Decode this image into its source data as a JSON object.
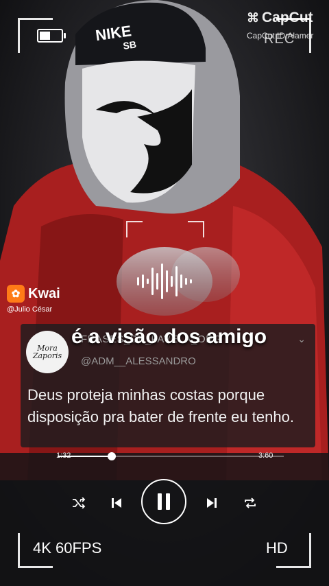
{
  "overlay": {
    "capcut_logo": "CapCut",
    "capcut_id": "CapCut ID:Alamer",
    "rec_label": "REC",
    "battery_level": 0.55
  },
  "kwai": {
    "brand": "Kwai",
    "user": "@Julio César"
  },
  "caption": "é a visão dos amigo",
  "tweet": {
    "avatar_text": "Mora Zaporis",
    "display_name": "FRASES_DE_FAVELA_ORG",
    "handle": "@ADM__ALESSANDRO",
    "text": "Deus proteja minhas costas porque disposição pra bater de frente eu tenho."
  },
  "player": {
    "current_time": "1:32",
    "total_time": "3:60",
    "progress": 0.24
  },
  "badges": {
    "fps": "4K 60FPS",
    "quality": "HD"
  },
  "colors": {
    "jacket_red": "#b32222",
    "hood_gray": "#9a9a9f",
    "kwai_orange": "#ff7b17"
  }
}
